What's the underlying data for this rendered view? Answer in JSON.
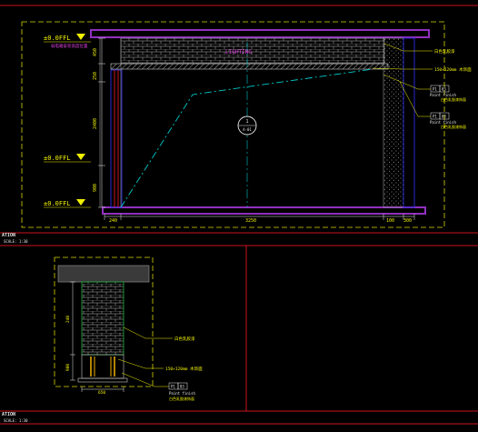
{
  "colors": {
    "background": "#000000",
    "frame_red": "#c8141e",
    "yellow": "#f0f000",
    "purple": "#9030c0",
    "magenta": "#e040e0",
    "cyan": "#00c8c8",
    "blue": "#2828d0",
    "white": "#e8e8e8",
    "grey": "#8c8c8c",
    "green": "#20b040"
  },
  "upper_elevation": {
    "title_tag": "ATION",
    "scale_note": "SCALE: 1:30",
    "level_marks": [
      "±0.0FFL",
      "±0.0FFL",
      "±0.0FFL"
    ],
    "red_note": "弱电箱安装高度位置",
    "ceiling_tag": "LIGHTING",
    "vertical_dims": [
      "450",
      "250",
      "2400",
      "900"
    ],
    "horizontal_dims": [
      "240",
      "3250",
      "100",
      "300"
    ],
    "section_marker": {
      "num": "1",
      "sub": "A-01"
    },
    "callouts": [
      {
        "text": "白色乳胶漆"
      },
      {
        "text": "150×120mm 木饰面",
        "sub": ""
      },
      {
        "code_a": "P1",
        "code_b": "03",
        "line1": "Paint finish",
        "line2": "白色乳胶漆饰面"
      },
      {
        "code_a": "P1",
        "code_b": "03",
        "line1": "Paint finish",
        "line2": "白色乳胶漆饰面"
      }
    ]
  },
  "lower_elevation": {
    "title_tag": "ATION",
    "scale_note": "SCALE: 1:30",
    "vertical_dims": [
      "240",
      "900"
    ],
    "horizontal_dims": [
      "650"
    ],
    "callouts": [
      {
        "text": "白色乳胶漆"
      },
      {
        "text": "150×120mm 木饰面"
      },
      {
        "code_a": "P1",
        "code_b": "03",
        "line1": "Paint finish",
        "line2": "白色乳胶漆饰面"
      }
    ]
  }
}
